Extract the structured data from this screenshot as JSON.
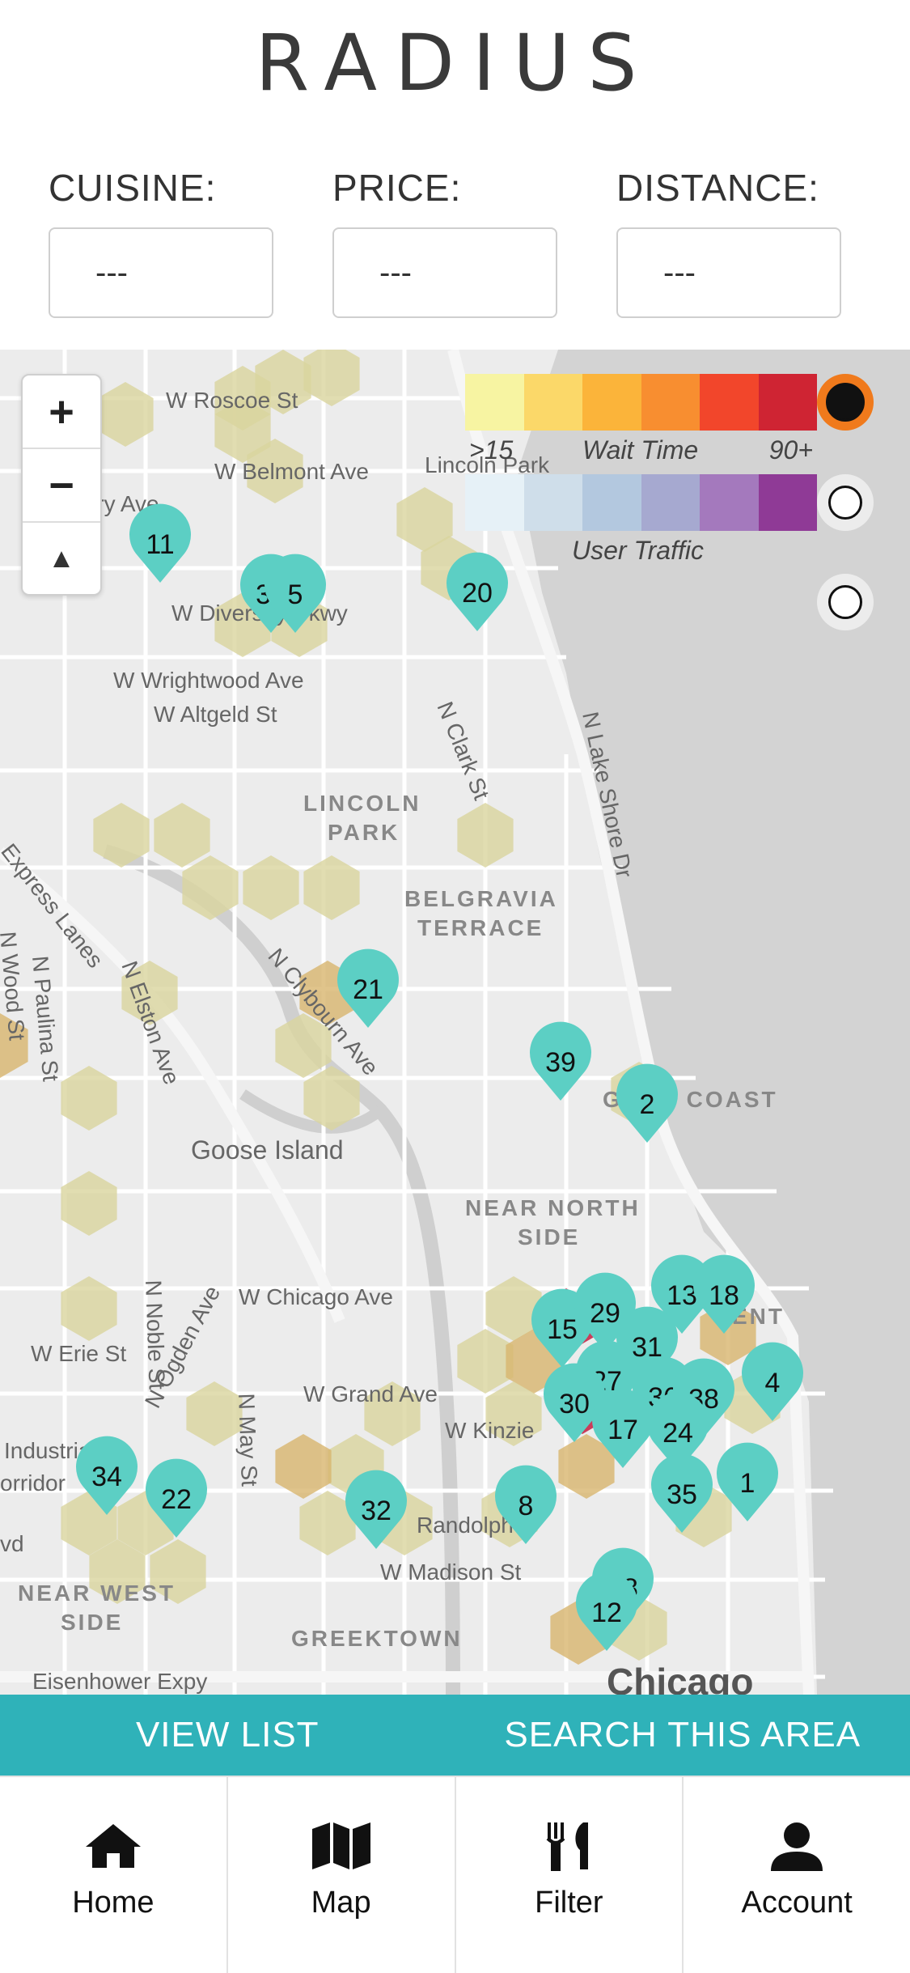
{
  "app": {
    "title": "RADIUS"
  },
  "filters": [
    {
      "label": "CUISINE:",
      "value": "---"
    },
    {
      "label": "PRICE:",
      "value": "---"
    },
    {
      "label": "DISTANCE:",
      "value": "---"
    }
  ],
  "map": {
    "zoom_in": "+",
    "zoom_out": "−",
    "compass": "▲",
    "streets": [
      "W Roscoe St",
      "W Belmont Ave",
      "rry Ave",
      "Lincoln Park",
      "W Diversey Pkwy",
      "W Wrightwood Ave",
      "W Altgeld St",
      "N Clark St",
      "N Lake Shore Dr",
      "Express Lanes",
      "N Wood St",
      "N Paulina St",
      "N Elston Ave",
      "N Clybourn Ave",
      "Goose Island",
      "W Chicago Ave",
      "W Erie St",
      "N Noble St",
      "N Ogden Ave",
      "N May St",
      "W Grand Ave",
      "W Kinzie",
      "Randolph",
      "W Madison St",
      "Industrial",
      "orridor",
      "vd",
      "Eisenhower Expy"
    ],
    "areas": [
      "LINCOLN",
      "PARK",
      "BELGRAVIA",
      "TERRACE",
      "NEAR NORTH",
      "SIDE",
      "NEAR WEST",
      "SIDE",
      "GREEKTOWN",
      "GOLD COAST",
      "ENT",
      "Chicago"
    ],
    "pins": [
      "11",
      "33",
      "5",
      "20",
      "21",
      "39",
      "2",
      "15",
      "29",
      "13",
      "18",
      "31",
      "27",
      "30",
      "36",
      "38",
      "4",
      "17",
      "24",
      "35",
      "1",
      "8",
      "34",
      "22",
      "32",
      "28",
      "12"
    ],
    "pin_color": "#5ccfc4",
    "legend": {
      "wait_time_label": "Wait Time",
      "wait_min": ">15",
      "wait_max": "90+",
      "traffic_label": "User Traffic",
      "wait_colors": [
        "#f7f4a2",
        "#fbd869",
        "#fbb43a",
        "#f88e30",
        "#f2462b",
        "#cf2433"
      ],
      "traffic_colors": [
        "#e6f1f7",
        "#cfdeea",
        "#b3c8df",
        "#a6a9d0",
        "#a479bd",
        "#8f3a96"
      ]
    }
  },
  "actions": {
    "view_list": "VIEW LIST",
    "search_area": "SEARCH THIS AREA"
  },
  "tabs": [
    {
      "label": "Home",
      "icon": "home-icon"
    },
    {
      "label": "Map",
      "icon": "map-icon"
    },
    {
      "label": "Filter",
      "icon": "fork-knife-icon"
    },
    {
      "label": "Account",
      "icon": "person-icon"
    }
  ]
}
